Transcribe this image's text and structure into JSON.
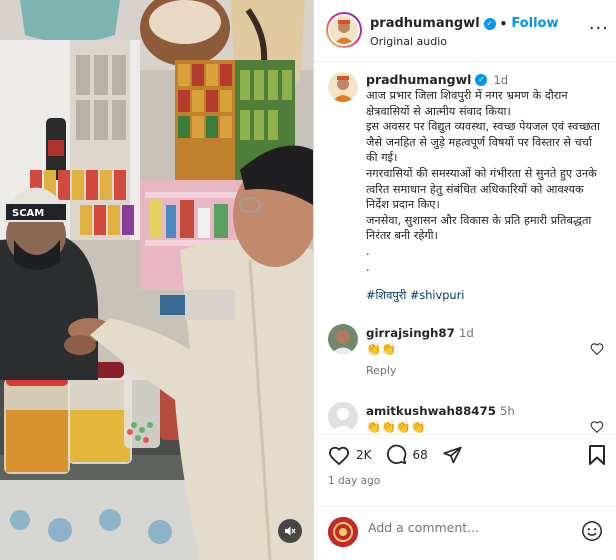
{
  "post": {
    "username": "pradhumangwl",
    "follow_label": "Follow",
    "audio": "Original audio",
    "dot": "•",
    "more": "···"
  },
  "caption": {
    "username": "pradhumangwl",
    "time": "1d",
    "text": "आज प्रभार जिला शिवपुरी में नगर भ्रमण के दौरान क्षेत्रवासियों से आत्मीय संवाद किया।\nइस अवसर पर विद्युत व्यवस्था, स्वच्छ पेयजल एवं स्वच्छता जैसे जनहित से जुड़े महत्वपूर्ण विषयों पर विस्तार से चर्चा की गई।\nनगरवासियों की समस्याओं को गंभीरता से सुनते हुए उनके त्वरित समाधान हेतु संबंधित अधिकारियों को आवश्यक निर्देश प्रदान किए।\nजनसेवा, सुशासन और विकास के प्रति हमारी प्रतिबद्धता निरंतर बनी रहेगी।\n.\n.",
    "hashtags": "#शिवपुरी #shivpuri"
  },
  "comments": [
    {
      "user": "girrajsingh87",
      "time": "1d",
      "text": "👏👏",
      "reply_label": "Reply"
    },
    {
      "user": "amitkushwah88475",
      "time": "5h",
      "text": "👏👏👏👏"
    }
  ],
  "actions": {
    "likes": "2K",
    "comments": "68",
    "posted": "1 day ago"
  },
  "add_comment": {
    "placeholder": "Add a comment..."
  },
  "colors": {
    "accent": "#0095f6",
    "text": "#262626",
    "muted": "#737373",
    "hashtag": "#00376b"
  }
}
